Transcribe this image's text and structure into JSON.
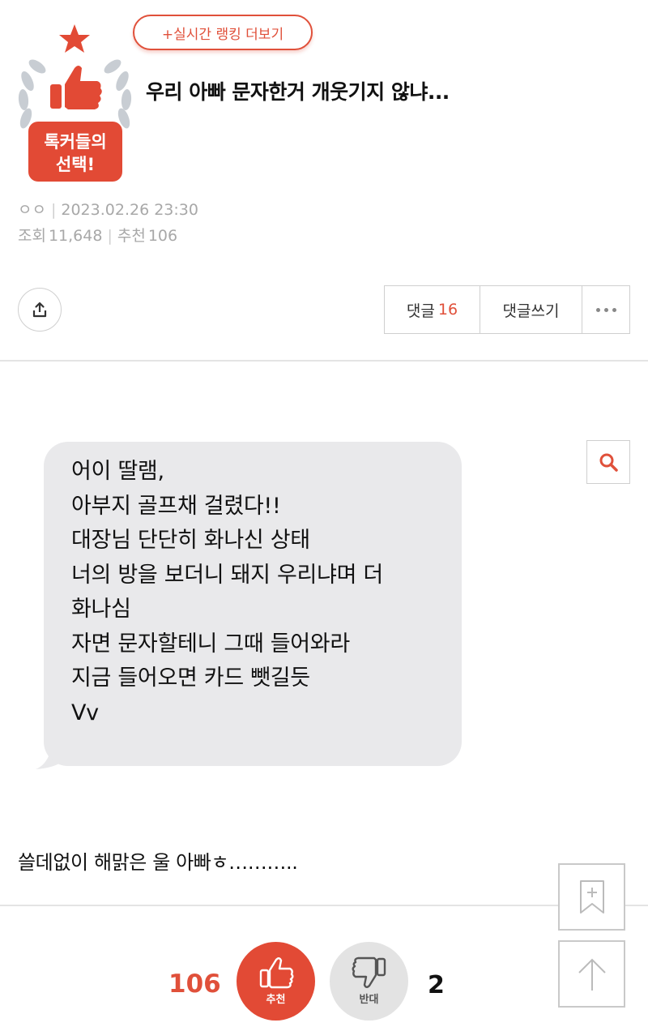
{
  "header": {
    "ranking_button": "+실시간 랭킹 더보기",
    "badge_label_line1": "톡커들의",
    "badge_label_line2": "선택!",
    "title": "우리 아빠 문자한거 개웃기지 않냐..."
  },
  "post_meta": {
    "author": "ㅇㅇ",
    "datetime": "2023.02.26 23:30",
    "views_label": "조회",
    "views": "11,648",
    "recommend_label": "추천",
    "recommends": "106"
  },
  "actions": {
    "comments_label": "댓글",
    "comments_count": "16",
    "write_comment": "댓글쓰기"
  },
  "message_bubble": {
    "text": "어이 딸램,\n아부지 골프채 걸렸다!!\n대장님 단단히 화나신 상태\n너의 방을 보더니 돼지 우리냐며 더\n화나심\n자면 문자할테니 그때 들어와라\n지금 들어오면 카드 뺏길듯\nVv"
  },
  "body": {
    "text": "쓸데없이 해맑은 울 아빠ㅎ……….."
  },
  "vote": {
    "up_count": "106",
    "up_label": "추천",
    "down_label": "반대",
    "down_count": "2"
  },
  "icons": {
    "share": "share-icon",
    "search": "search-icon",
    "more": "more-dots-icon",
    "bookmark": "bookmark-add-icon",
    "scroll_top": "arrow-up-icon",
    "thumbs_up": "thumbs-up-icon",
    "thumbs_down": "thumbs-down-icon"
  },
  "colors": {
    "accent": "#e0503a",
    "badge_laurel": "#c8cdd3",
    "bubble": "#e9e9eb"
  }
}
